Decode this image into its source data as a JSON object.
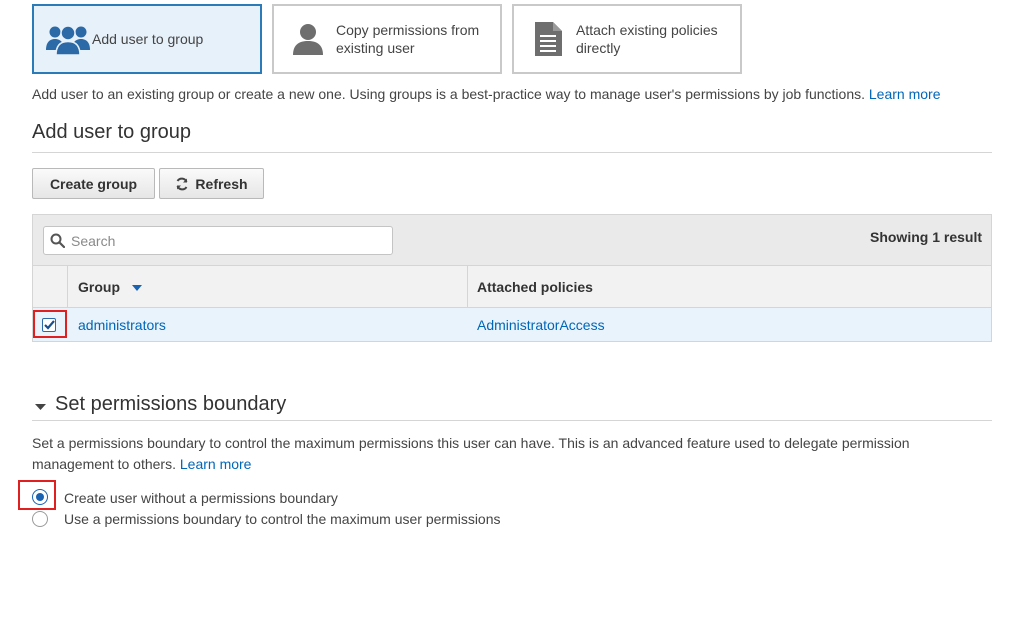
{
  "options": [
    {
      "label_line1": "Add user to group",
      "label_line2": "",
      "icon": "group-icon",
      "selected": true
    },
    {
      "label_line1": "Copy permissions from",
      "label_line2": "existing user",
      "icon": "user-icon",
      "selected": false
    },
    {
      "label_line1": "Attach existing policies",
      "label_line2": "directly",
      "icon": "document-icon",
      "selected": false
    }
  ],
  "description": {
    "text": "Add user to an existing group or create a new one. Using groups is a best-practice way to manage user's permissions by job functions.",
    "link": "Learn more"
  },
  "group_section": {
    "title": "Add user to group",
    "create_button": "Create group",
    "refresh_button": "Refresh"
  },
  "table": {
    "search_placeholder": "Search",
    "showing": "Showing 1 result",
    "columns": [
      "Group",
      "Attached policies"
    ],
    "rows": [
      {
        "checked": true,
        "group": "administrators",
        "policies": "AdministratorAccess"
      }
    ]
  },
  "boundary": {
    "title": "Set permissions boundary",
    "description_line1": "Set a permissions boundary to control the maximum permissions this user can have. This is an advanced feature used to delegate permission",
    "description_line2": "management to others.",
    "link": "Learn more",
    "options": [
      {
        "label": "Create user without a permissions boundary",
        "selected": true
      },
      {
        "label": "Use a permissions boundary to control the maximum user permissions",
        "selected": false
      }
    ]
  },
  "colors": {
    "accent": "#2b7bb9",
    "link": "#0066b8",
    "selected_row": "#e8f3fb",
    "highlight": "#e02020"
  }
}
